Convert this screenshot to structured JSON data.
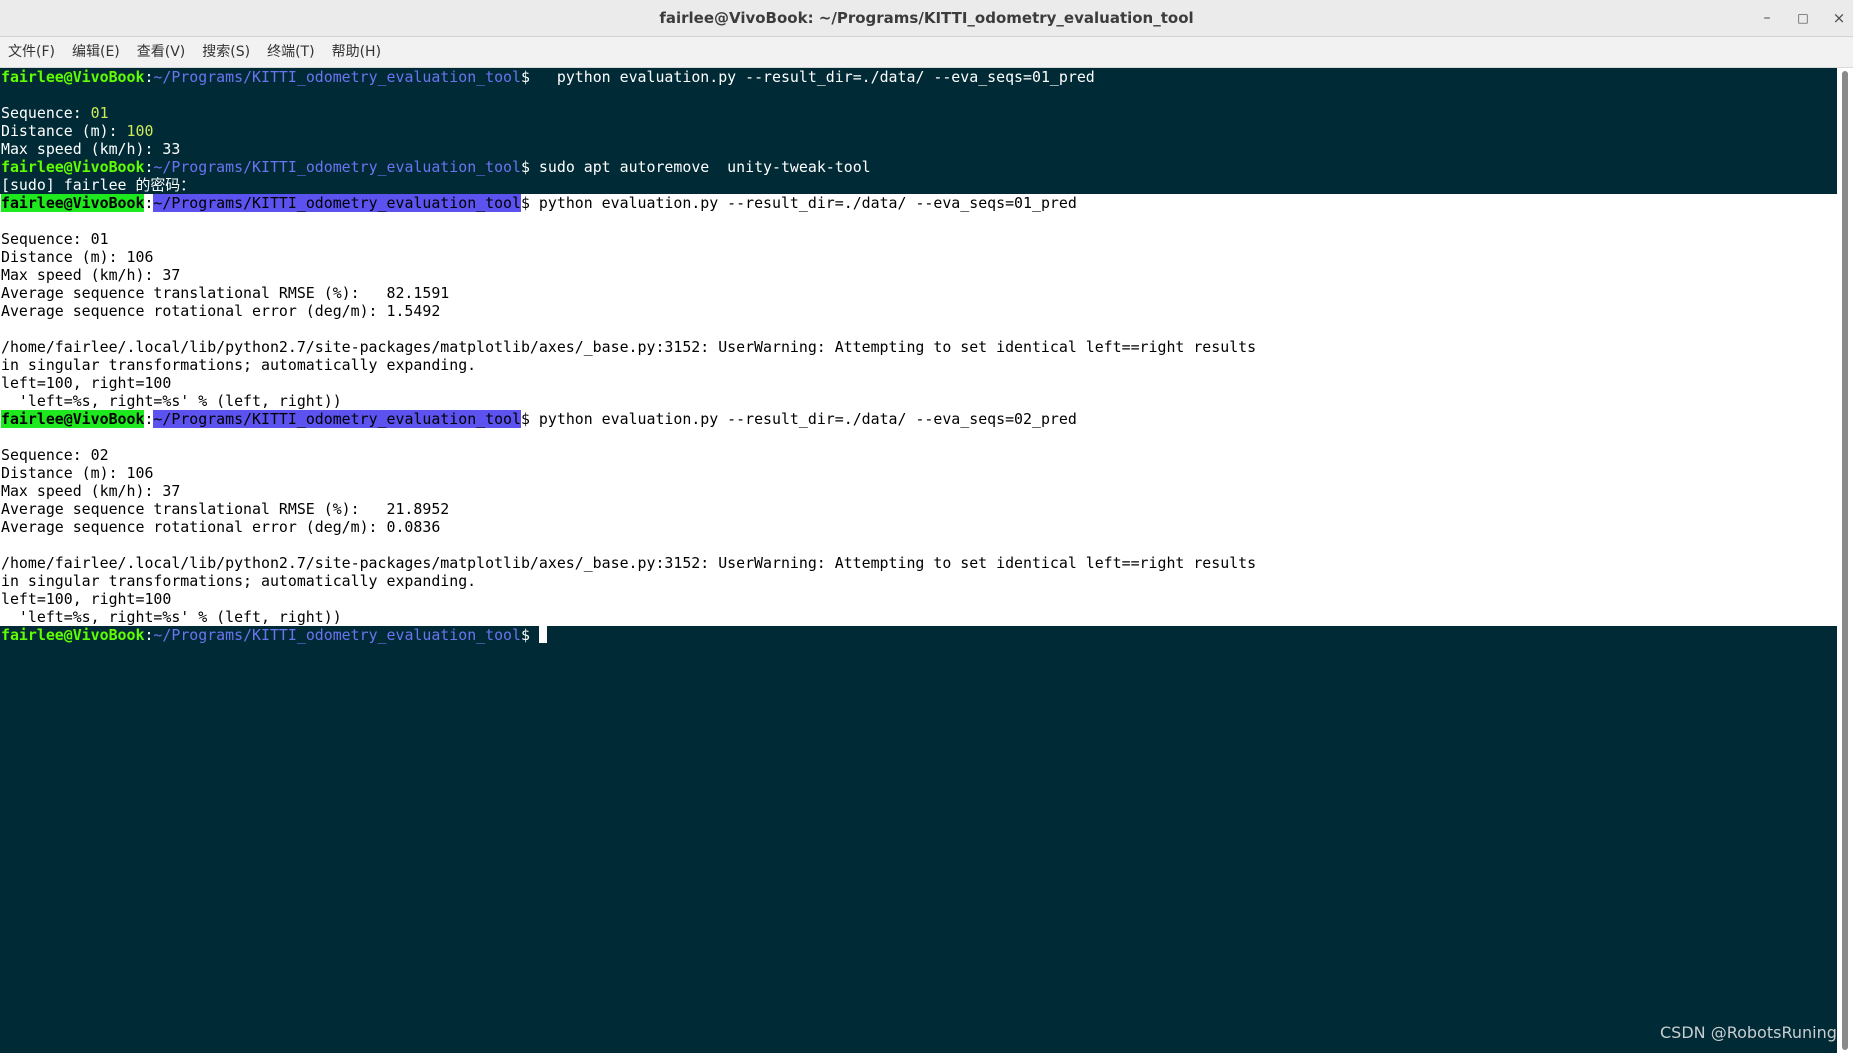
{
  "window": {
    "title": "fairlee@VivoBook: ~/Programs/KITTI_odometry_evaluation_tool",
    "min_glyph": "–",
    "max_glyph": "□",
    "close_glyph": "×"
  },
  "menu": [
    "文件(F)",
    "编辑(E)",
    "查看(V)",
    "搜索(S)",
    "终端(T)",
    "帮助(H)"
  ],
  "prompt": {
    "user": "fairlee@VivoBook",
    "colon": ":",
    "path": "~/Programs/KITTI_odometry_evaluation_tool",
    "dollar": "$"
  },
  "terminal": {
    "cmd1": "   python evaluation.py --result_dir=./data/ --eva_seqs=01_pred",
    "block1": {
      "seq_label": "Sequence: ",
      "seq": "01",
      "dist_label": "Distance (m): ",
      "dist": "100",
      "speed_label": "Max speed (km/h): ",
      "speed": "33"
    },
    "cmd2": " sudo apt autoremove  unity-tweak-tool",
    "sudo_line": "[sudo] fairlee 的密码：",
    "cmd3": " python evaluation.py --result_dir=./data/ --eva_seqs=01_pred",
    "block2": [
      "Sequence: 01",
      "Distance (m): 106",
      "Max speed (km/h): 37",
      "Average sequence translational RMSE (%):   82.1591",
      "Average sequence rotational error (deg/m): 1.5492",
      "",
      "/home/fairlee/.local/lib/python2.7/site-packages/matplotlib/axes/_base.py:3152: UserWarning: Attempting to set identical left==right results",
      "in singular transformations; automatically expanding.",
      "left=100, right=100",
      "  'left=%s, right=%s' % (left, right))"
    ],
    "cmd4": " python evaluation.py --result_dir=./data/ --eva_seqs=02_pred",
    "block3": [
      "Sequence: 02",
      "Distance (m): 106",
      "Max speed (km/h): 37",
      "Average sequence translational RMSE (%):   21.8952",
      "Average sequence rotational error (deg/m): 0.0836",
      "",
      "/home/fairlee/.local/lib/python2.7/site-packages/matplotlib/axes/_base.py:3152: UserWarning: Attempting to set identical left==right results",
      "in singular transformations; automatically expanding.",
      "left=100, right=100",
      "  'left=%s, right=%s' % (left, right))"
    ],
    "final_gap": " "
  },
  "watermark": "CSDN @RobotsRuning",
  "colors": {
    "background": "#002b36",
    "prompt_user": "#5fff00",
    "prompt_path": "#6b73f0",
    "number": "#cfe85a",
    "selection": "#ffffff"
  }
}
